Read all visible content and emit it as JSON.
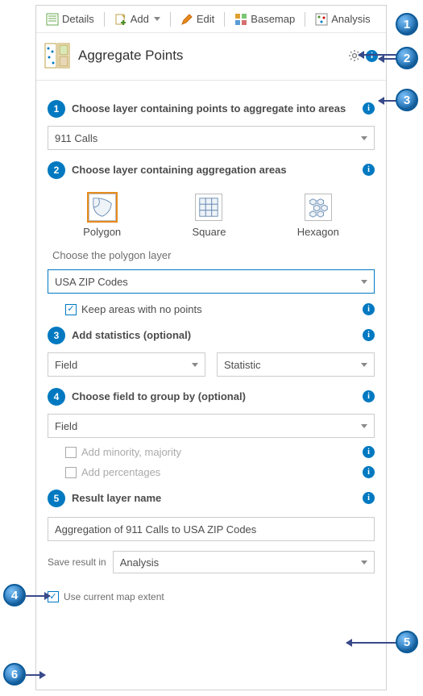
{
  "toolbar": {
    "details": "Details",
    "add": "Add",
    "edit": "Edit",
    "basemap": "Basemap",
    "analysis": "Analysis"
  },
  "header": {
    "title": "Aggregate Points"
  },
  "step1": {
    "label": "Choose layer containing points to aggregate into areas",
    "value": "911 Calls"
  },
  "step2": {
    "label": "Choose layer containing aggregation areas",
    "shapes": {
      "polygon": "Polygon",
      "square": "Square",
      "hexagon": "Hexagon"
    },
    "sublabel": "Choose the polygon layer",
    "value": "USA ZIP Codes",
    "keep": "Keep areas with no points"
  },
  "step3": {
    "label": "Add statistics (optional)",
    "field": "Field",
    "stat": "Statistic"
  },
  "step4": {
    "label": "Choose field to group by (optional)",
    "value": "Field",
    "minmaj": "Add minority, majority",
    "pct": "Add percentages"
  },
  "step5": {
    "label": "Result layer name",
    "value": "Aggregation of 911 Calls to USA ZIP Codes",
    "savelbl": "Save result in",
    "savefolder": "Analysis"
  },
  "extent": "Use current map extent",
  "annotations": {
    "b1": "1",
    "b2": "2",
    "b3": "3",
    "b4": "4",
    "b5": "5",
    "b6": "6"
  }
}
